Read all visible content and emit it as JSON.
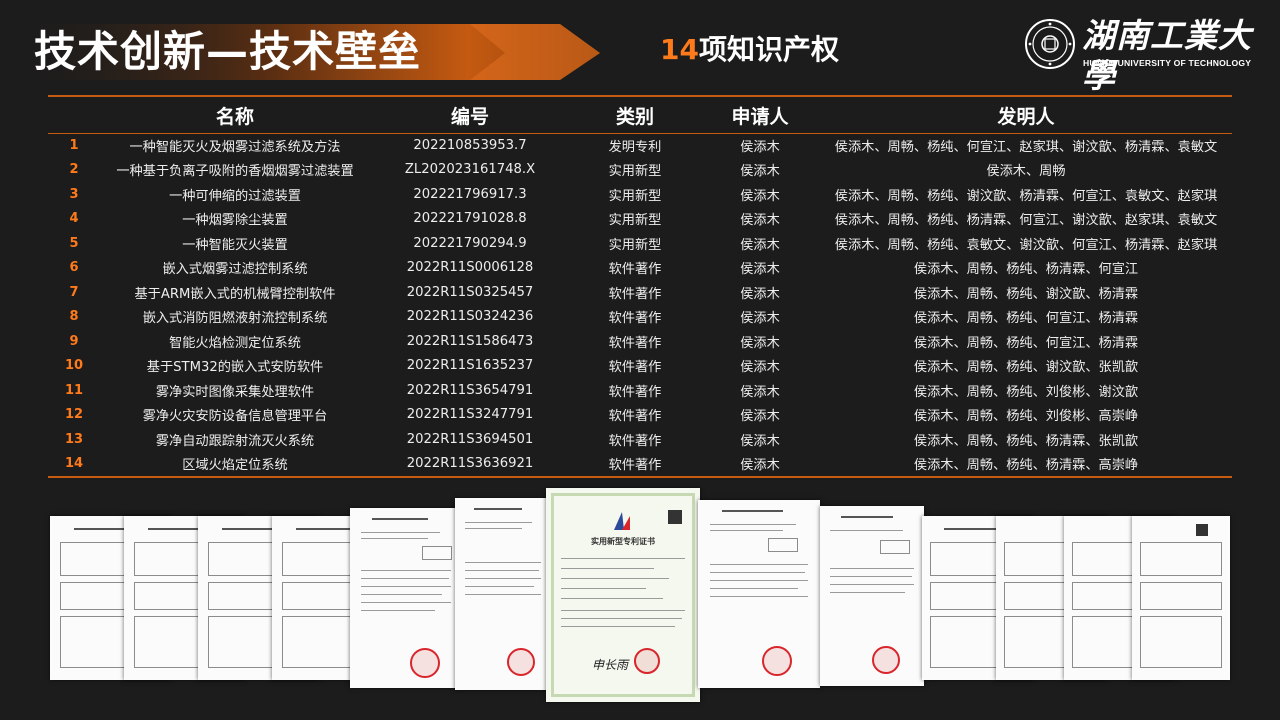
{
  "header": {
    "title": "技术创新—技术壁垒",
    "subtitle_count": "14",
    "subtitle_text": "项知识产权",
    "logo_name": "湖南工業大學",
    "logo_en": "HUNAN UNIVERSITY OF TECHNOLOGY"
  },
  "colors": {
    "accent": "#c55a11",
    "highlight": "#ff7a1a",
    "background": "#1c1c1c",
    "stamp": "#d8262c"
  },
  "table": {
    "columns": [
      "",
      "名称",
      "编号",
      "类别",
      "申请人",
      "发明人"
    ],
    "rows": [
      {
        "idx": "1",
        "name": "一种智能灭火及烟雾过滤系统及方法",
        "number": "202210853953.7",
        "type": "发明专利",
        "applicant": "侯添木",
        "inventors": "侯添木、周畅、杨纯、何宣江、赵家琪、谢汶歆、杨清霖、袁敏文"
      },
      {
        "idx": "2",
        "name": "一种基于负离子吸附的香烟烟雾过滤装置",
        "number": "ZL202023161748.X",
        "type": "实用新型",
        "applicant": "侯添木",
        "inventors": "侯添木、周畅"
      },
      {
        "idx": "3",
        "name": "一种可伸缩的过滤装置",
        "number": "202221796917.3",
        "type": "实用新型",
        "applicant": "侯添木",
        "inventors": "侯添木、周畅、杨纯、谢汶歆、杨清霖、何宣江、袁敏文、赵家琪"
      },
      {
        "idx": "4",
        "name": "一种烟雾除尘装置",
        "number": "202221791028.8",
        "type": "实用新型",
        "applicant": "侯添木",
        "inventors": "侯添木、周畅、杨纯、杨清霖、何宣江、谢汶歆、赵家琪、袁敏文"
      },
      {
        "idx": "5",
        "name": "一种智能灭火装置",
        "number": "202221790294.9",
        "type": "实用新型",
        "applicant": "侯添木",
        "inventors": "侯添木、周畅、杨纯、袁敏文、谢汶歆、何宣江、杨清霖、赵家琪"
      },
      {
        "idx": "6",
        "name": "嵌入式烟雾过滤控制系统",
        "number": "2022R11S0006128",
        "type": "软件著作",
        "applicant": "侯添木",
        "inventors": "侯添木、周畅、杨纯、杨清霖、何宣江"
      },
      {
        "idx": "7",
        "name": "基于ARM嵌入式的机械臂控制软件",
        "number": "2022R11S0325457",
        "type": "软件著作",
        "applicant": "侯添木",
        "inventors": "侯添木、周畅、杨纯、谢汶歆、杨清霖"
      },
      {
        "idx": "8",
        "name": "嵌入式消防阻燃液射流控制系统",
        "number": "2022R11S0324236",
        "type": "软件著作",
        "applicant": "侯添木",
        "inventors": "侯添木、周畅、杨纯、何宣江、杨清霖"
      },
      {
        "idx": "9",
        "name": "智能火焰检测定位系统",
        "number": "2022R11S1586473",
        "type": "软件著作",
        "applicant": "侯添木",
        "inventors": "侯添木、周畅、杨纯、何宣江、杨清霖"
      },
      {
        "idx": "10",
        "name": "基于STM32的嵌入式安防软件",
        "number": "2022R11S1635237",
        "type": "软件著作",
        "applicant": "侯添木",
        "inventors": "侯添木、周畅、杨纯、谢汶歆、张凯歆"
      },
      {
        "idx": "11",
        "name": "雾净实时图像采集处理软件",
        "number": "2022R11S3654791",
        "type": "软件著作",
        "applicant": "侯添木",
        "inventors": "侯添木、周畅、杨纯、刘俊彬、谢汶歆"
      },
      {
        "idx": "12",
        "name": "雾净火灾安防设备信息管理平台",
        "number": "2022R11S3247791",
        "type": "软件著作",
        "applicant": "侯添木",
        "inventors": "侯添木、周畅、杨纯、刘俊彬、高崇峥"
      },
      {
        "idx": "13",
        "name": "雾净自动跟踪射流灭火系统",
        "number": "2022R11S3694501",
        "type": "软件著作",
        "applicant": "侯添木",
        "inventors": "侯添木、周畅、杨纯、杨清霖、张凯歆"
      },
      {
        "idx": "14",
        "name": "区域火焰定位系统",
        "number": "2022R11S3636921",
        "type": "软件著作",
        "applicant": "侯添木",
        "inventors": "侯添木、周畅、杨纯、杨清霖、高崇峥"
      }
    ]
  },
  "certificates": {
    "center_title": "实用新型专利证书",
    "center_signature": "申长雨"
  }
}
